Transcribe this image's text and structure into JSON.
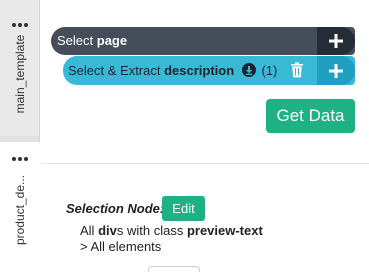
{
  "tabs": [
    {
      "label": "main_template",
      "active": false
    },
    {
      "label": "product_de...",
      "active": true
    }
  ],
  "tab_menu_icon": "more-dots-icon",
  "commands": {
    "select": {
      "prefix": "Select",
      "target": "page"
    },
    "extract": {
      "prefix": "Select & Extract",
      "target": "description",
      "count": "(1)"
    }
  },
  "icons": {
    "plus": "plus-icon",
    "download": "download-circle-icon",
    "trash": "trash-icon"
  },
  "get_data_label": "Get Data",
  "selection": {
    "label": "Selection Node:",
    "edit_label": "Edit",
    "line1": {
      "a": "All ",
      "b": "div",
      "c": "s with class ",
      "d": "preview-text"
    },
    "line2": "> All elements"
  },
  "colors": {
    "select_bar": "#454d5b",
    "extract_bar": "#38b9d6",
    "green": "#1db184"
  }
}
